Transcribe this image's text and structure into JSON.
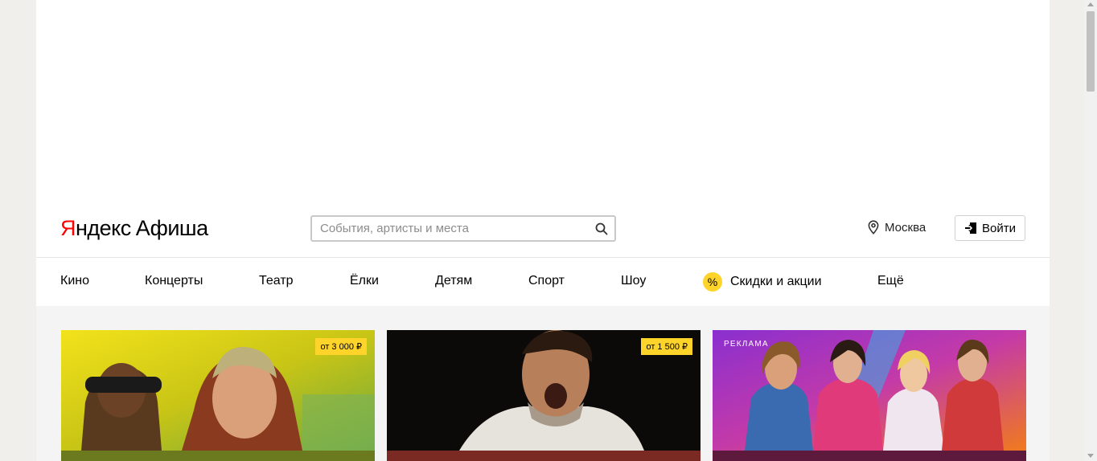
{
  "logo": {
    "brand_red": "Я",
    "brand_rest": "ндекс",
    "service": "Афиша"
  },
  "search": {
    "placeholder": "События, артисты и места",
    "value": "",
    "icon": "search-icon"
  },
  "city": {
    "icon": "location-pin-icon",
    "name": "Москва"
  },
  "login": {
    "icon": "login-icon",
    "label": "Войти"
  },
  "nav": {
    "items": [
      {
        "label": "Кино"
      },
      {
        "label": "Концерты"
      },
      {
        "label": "Театр"
      },
      {
        "label": "Ёлки"
      },
      {
        "label": "Детям"
      },
      {
        "label": "Спорт"
      },
      {
        "label": "Шоу"
      },
      {
        "label": "Скидки и акции",
        "badge": "%"
      },
      {
        "label": "Ещё"
      }
    ]
  },
  "cards": [
    {
      "price": "от 3 000 ₽",
      "bottom_color": "#6b7a1e"
    },
    {
      "price": "от 1 500 ₽",
      "bottom_color": "#7a2a22"
    },
    {
      "ad_label": "РЕКЛАМА",
      "bottom_color": "#5d1a3c"
    }
  ],
  "colors": {
    "accent_yellow": "#fed42b",
    "brand_red": "#ff0000"
  }
}
